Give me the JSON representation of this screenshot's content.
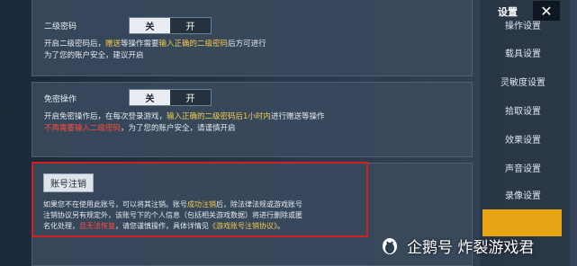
{
  "panel": {
    "second_password": {
      "title": "二级密码",
      "toggle_off": "关",
      "toggle_on": "开",
      "desc1_a": "开启二级密码后，",
      "desc1_b": "赠送",
      "desc1_c": "等操作需要",
      "desc1_d": "输入正确的二级密码",
      "desc1_e": "后方可进行",
      "desc2": "为了您的账户安全，建议开启"
    },
    "password_free": {
      "title": "免密操作",
      "toggle_off": "关",
      "toggle_on": "开",
      "desc1_a": "开启免密操作后，在每次登录游戏，",
      "desc1_b": "输入正确的二级密码后1小时内",
      "desc1_c": "进行赠送等操作",
      "desc2_a": "不再需要输入二级密码",
      "desc2_b": "，为了您的账户安全，请谨慎开启"
    },
    "account_cancel": {
      "button": "账号注销",
      "l1_a": "如果您不在使用此账号，可以将其注销。账号",
      "l1_b": "成功注销",
      "l1_c": "后，除法律法规或游戏账号",
      "l2": "注销协议另有规定外，该账号下的个人信息（包括相关游戏数据）将进行删除或匿",
      "l3_a": "名化处理，",
      "l3_b": "且无法恢复",
      "l3_c": "，请您谨慎操作，具体详情见",
      "l3_d": "《游戏账号注销协议》",
      "l3_e": "。"
    }
  },
  "sidebar": {
    "title": "设置",
    "items": [
      {
        "label": "操作设置"
      },
      {
        "label": "载具设置"
      },
      {
        "label": "灵敏度设置"
      },
      {
        "label": "拾取设置"
      },
      {
        "label": "效果设置"
      },
      {
        "label": "声音设置"
      },
      {
        "label": "录像设置"
      }
    ]
  },
  "watermark": "企鹅号 炸裂游戏君",
  "colors": {
    "highlight": "#f2c94c",
    "alert": "#ff4a3d",
    "frame": "#d2201f",
    "active_tab": "#e8a415"
  },
  "icons": {
    "close": "close-icon",
    "logo": "penguin-logo-icon"
  }
}
